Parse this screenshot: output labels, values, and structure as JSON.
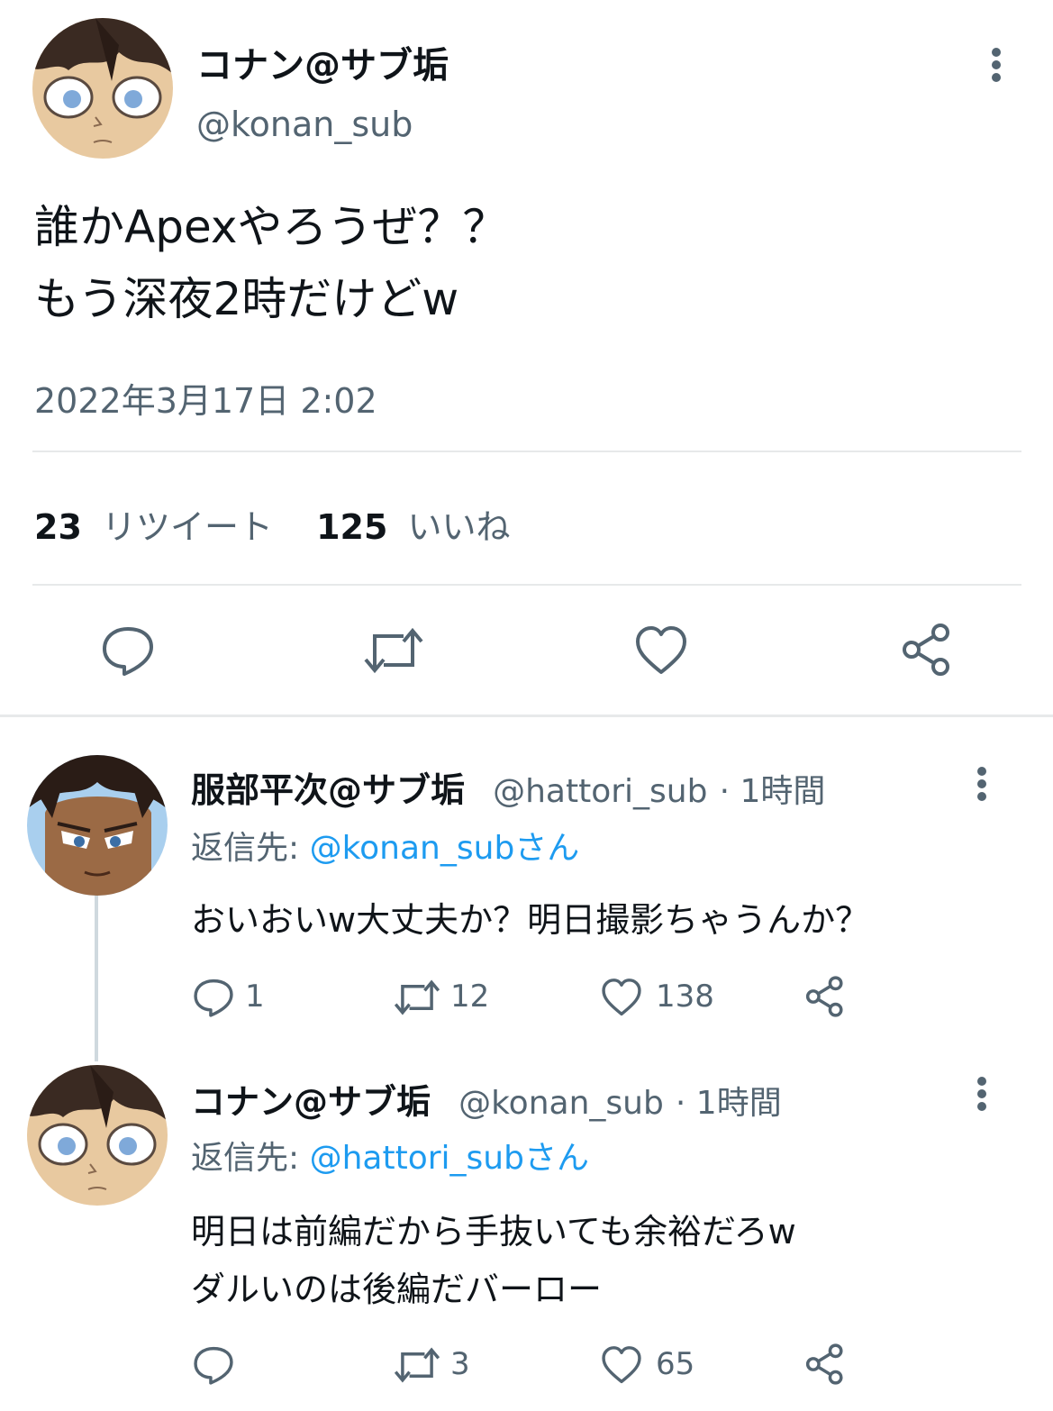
{
  "main_tweet": {
    "display_name": "コナン@サブ垢",
    "handle": "@konan_sub",
    "text_line1": "誰かApexやろうぜ？？",
    "text_line2": "もう深夜2時だけどw",
    "timestamp": "2022年3月17日 2:02",
    "retweet_count": "23",
    "retweet_label": "リツイート",
    "like_count": "125",
    "like_label": "いいね"
  },
  "replies": [
    {
      "display_name": "服部平次@サブ垢",
      "handle": "@hattori_sub",
      "time": "· 1時間",
      "reply_to_prefix": "返信先:",
      "reply_to_handle": "@konan_subさん",
      "text_line1": "おいおいw大丈夫か？明日撮影ちゃうんか？",
      "text_line2": "",
      "reply_count": "1",
      "retweet_count": "12",
      "like_count": "138"
    },
    {
      "display_name": "コナン@サブ垢",
      "handle": "@konan_sub",
      "time": "· 1時間",
      "reply_to_prefix": "返信先:",
      "reply_to_handle": "@hattori_subさん",
      "text_line1": "明日は前編だから手抜いても余裕だろw",
      "text_line2": "ダルいのは後編だバーロー",
      "reply_count": "",
      "retweet_count": "3",
      "like_count": "65"
    }
  ],
  "colors": {
    "text_primary": "#0f1419",
    "text_secondary": "#536471",
    "link_blue": "#1d9bf0",
    "divider": "#e7e9ea"
  },
  "icons": [
    "more-icon",
    "reply-icon",
    "retweet-icon",
    "like-icon",
    "share-icon"
  ]
}
